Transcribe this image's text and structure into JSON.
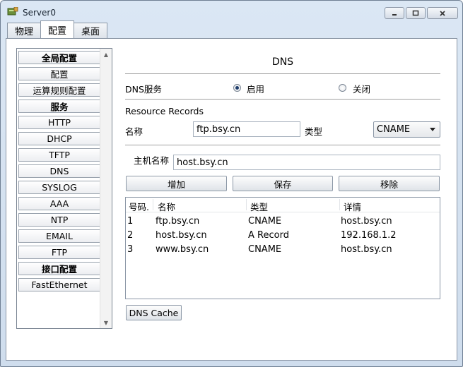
{
  "window": {
    "title": "Server0",
    "buttons": {
      "minimize": "minimize",
      "maximize": "maximize",
      "close": "close"
    }
  },
  "tabs": [
    {
      "label": "物理",
      "active": false
    },
    {
      "label": "配置",
      "active": true
    },
    {
      "label": "桌面",
      "active": false
    }
  ],
  "sidebar": {
    "items": [
      {
        "label": "全局配置",
        "header": true
      },
      {
        "label": "配置",
        "header": false
      },
      {
        "label": "运算规则配置",
        "header": false
      },
      {
        "label": "服务",
        "header": true
      },
      {
        "label": "HTTP",
        "header": false
      },
      {
        "label": "DHCP",
        "header": false
      },
      {
        "label": "TFTP",
        "header": false
      },
      {
        "label": "DNS",
        "header": false
      },
      {
        "label": "SYSLOG",
        "header": false
      },
      {
        "label": "AAA",
        "header": false
      },
      {
        "label": "NTP",
        "header": false
      },
      {
        "label": "EMAIL",
        "header": false
      },
      {
        "label": "FTP",
        "header": false
      },
      {
        "label": "接口配置",
        "header": true
      },
      {
        "label": "FastEthernet",
        "header": false
      }
    ]
  },
  "dns": {
    "title": "DNS",
    "service_label": "DNS服务",
    "on_label": "启用",
    "off_label": "关闭",
    "service_enabled": true,
    "records_title": "Resource Records",
    "name_label": "名称",
    "name_value": "ftp.bsy.cn",
    "type_label": "类型",
    "type_value": "CNAME",
    "host_label": "主机名称",
    "host_value": "host.bsy.cn",
    "add_button": "增加",
    "save_button": "保存",
    "remove_button": "移除",
    "table": {
      "columns": [
        "号码.",
        "名称",
        "类型",
        "详情"
      ],
      "rows": [
        [
          "1",
          "ftp.bsy.cn",
          "CNAME",
          "host.bsy.cn"
        ],
        [
          "2",
          "host.bsy.cn",
          "A Record",
          "192.168.1.2"
        ],
        [
          "3",
          "www.bsy.cn",
          "CNAME",
          "host.bsy.cn"
        ]
      ]
    },
    "cache_button": "DNS Cache"
  }
}
